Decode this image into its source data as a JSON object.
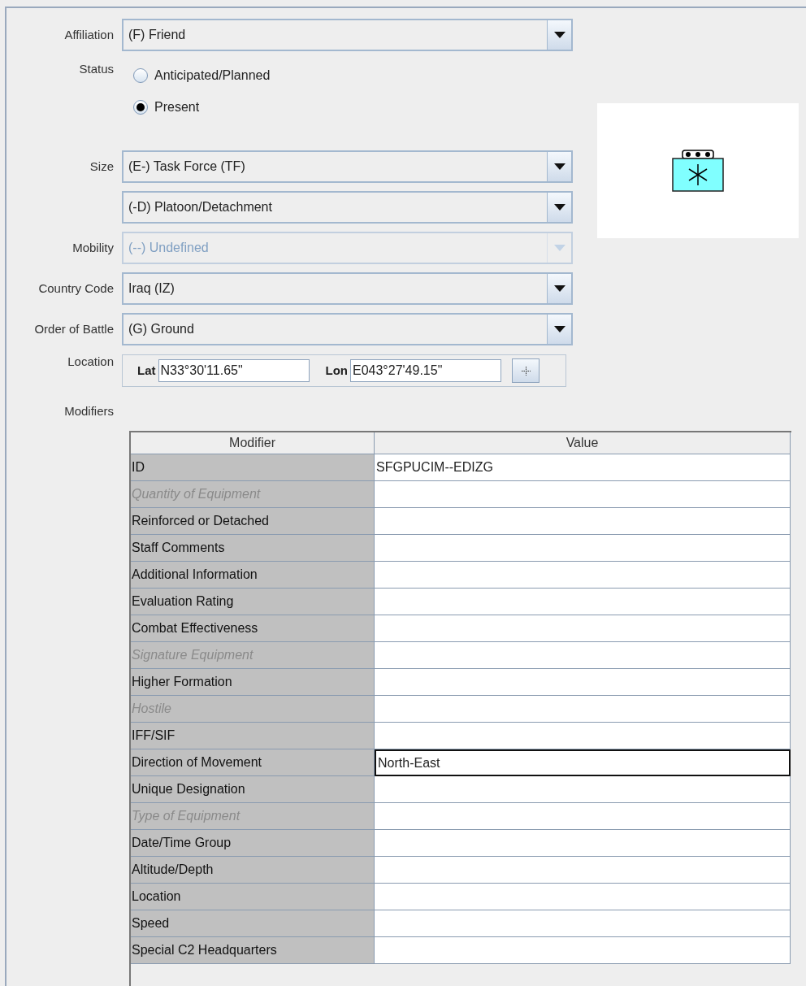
{
  "fields": [
    {
      "kind": "combo",
      "label": "Affiliation",
      "value": "(F) Friend",
      "disabled": false
    },
    {
      "kind": "radio",
      "label": "Status",
      "options": [
        {
          "label": "Anticipated/Planned",
          "selected": false
        },
        {
          "label": "Present",
          "selected": true
        }
      ]
    },
    {
      "kind": "combo",
      "label": "Size",
      "value": "(E-) Task Force (TF)",
      "disabled": false
    },
    {
      "kind": "combo",
      "value": "(-D) Platoon/Detachment",
      "disabled": false
    },
    {
      "kind": "combo",
      "label": "Mobility",
      "value": "(--) Undefined",
      "disabled": true
    },
    {
      "kind": "combo",
      "label": "Country Code",
      "value": "Iraq (IZ)",
      "disabled": false
    },
    {
      "kind": "combo",
      "label": "Order of Battle",
      "value": "(G) Ground",
      "disabled": false
    },
    {
      "kind": "location",
      "label": "Location",
      "lat_label": "Lat",
      "lat": "N33°30'11.65\"",
      "lon_label": "Lon",
      "lon": "E043°27'49.15\""
    }
  ],
  "modifiers": {
    "label": "Modifiers",
    "columns": [
      "Modifier",
      "Value"
    ],
    "rows": [
      {
        "modifier": "ID",
        "value": "SFGPUCIM--EDIZG",
        "disabled": false,
        "focused": false
      },
      {
        "modifier": "Quantity of Equipment",
        "disabled": true,
        "focused": false
      },
      {
        "modifier": "Reinforced or Detached",
        "disabled": false,
        "focused": false
      },
      {
        "modifier": "Staff Comments",
        "disabled": false,
        "focused": false
      },
      {
        "modifier": "Additional Information",
        "disabled": false,
        "focused": false
      },
      {
        "modifier": "Evaluation Rating",
        "disabled": false,
        "focused": false
      },
      {
        "modifier": "Combat Effectiveness",
        "disabled": false,
        "focused": false
      },
      {
        "modifier": "Signature Equipment",
        "disabled": true,
        "focused": false
      },
      {
        "modifier": "Higher Formation",
        "disabled": false,
        "focused": false
      },
      {
        "modifier": "Hostile",
        "disabled": true,
        "focused": false
      },
      {
        "modifier": "IFF/SIF",
        "disabled": false,
        "focused": false
      },
      {
        "modifier": "Direction of Movement",
        "value": "North-East",
        "disabled": false,
        "focused": true
      },
      {
        "modifier": "Unique Designation",
        "disabled": false,
        "focused": false
      },
      {
        "modifier": "Type of Equipment",
        "disabled": true,
        "focused": false
      },
      {
        "modifier": "Date/Time Group",
        "disabled": false,
        "focused": false
      },
      {
        "modifier": "Altitude/Depth",
        "disabled": false,
        "focused": false
      },
      {
        "modifier": "Location",
        "disabled": false,
        "focused": false
      },
      {
        "modifier": "Speed",
        "disabled": false,
        "focused": false
      },
      {
        "modifier": "Special C2 Headquarters",
        "disabled": false,
        "focused": false
      }
    ]
  }
}
